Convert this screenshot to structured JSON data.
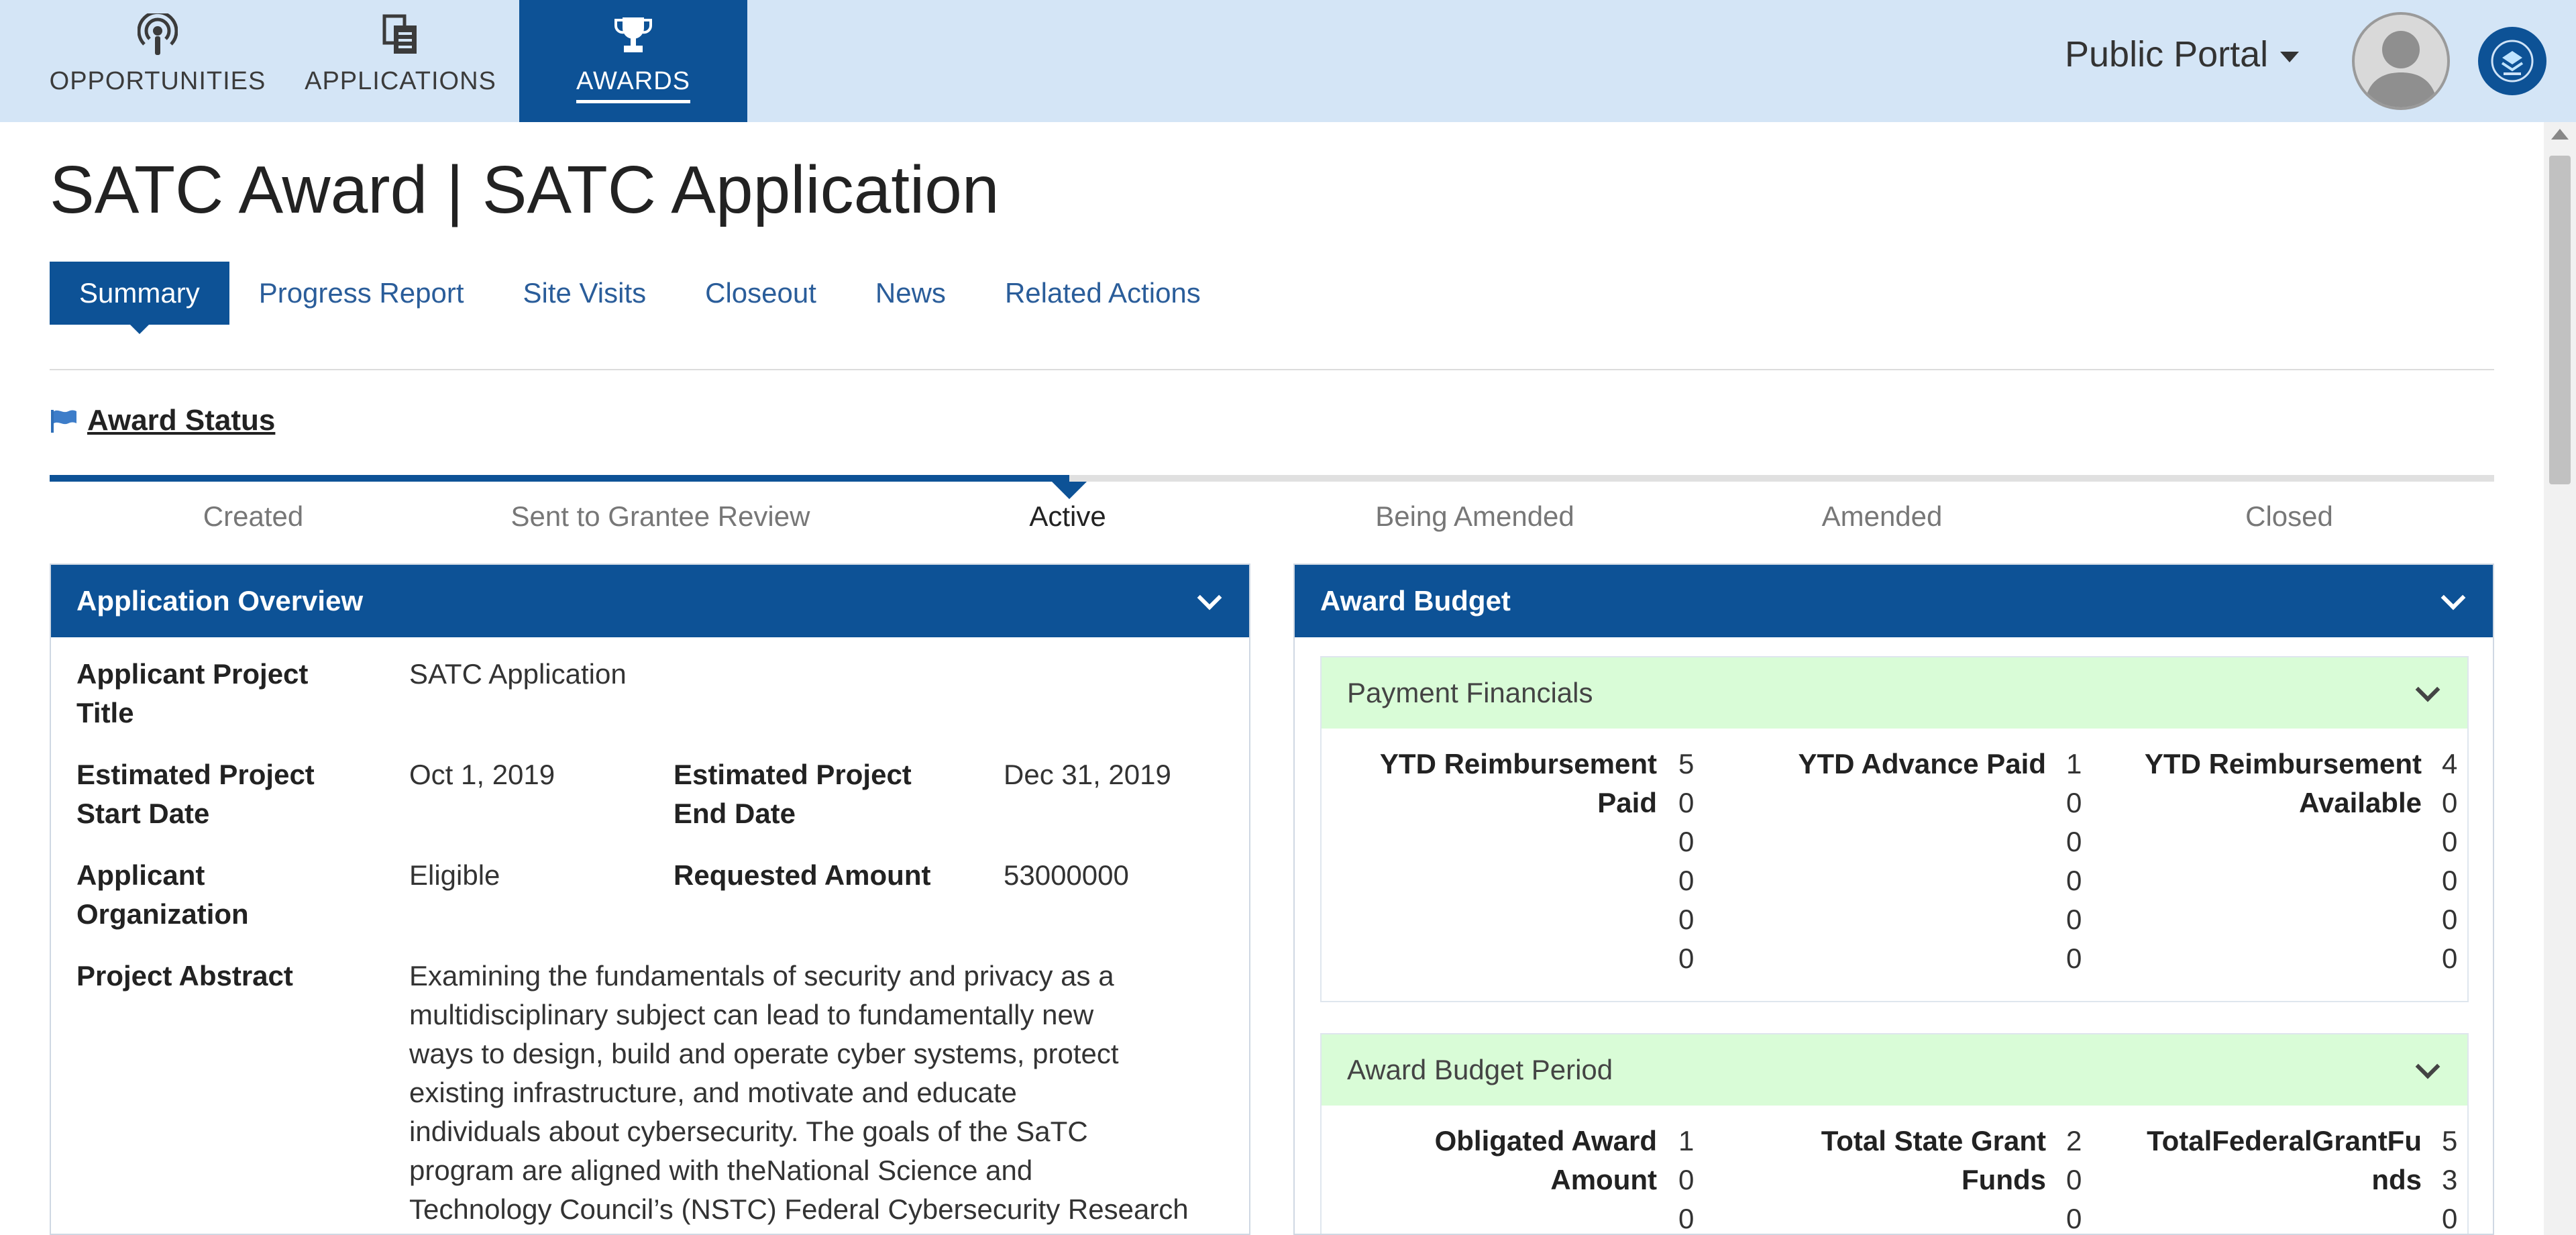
{
  "nav": {
    "items": [
      {
        "label": "OPPORTUNITIES",
        "icon": "podcast-icon"
      },
      {
        "label": "APPLICATIONS",
        "icon": "documents-icon"
      },
      {
        "label": "AWARDS",
        "icon": "trophy-icon",
        "active": true
      }
    ],
    "portal_label": "Public Portal",
    "colors": {
      "bar": "#d4e5f6",
      "active": "#0d5296"
    }
  },
  "page": {
    "title": "SATC Award | SATC Application",
    "tabs": [
      "Summary",
      "Progress Report",
      "Site Visits",
      "Closeout",
      "News",
      "Related Actions"
    ],
    "active_tab": "Summary"
  },
  "award_status": {
    "title": "Award Status",
    "stages": [
      "Created",
      "Sent to Grantee Review",
      "Active",
      "Being Amended",
      "Amended",
      "Closed"
    ],
    "current_stage": "Active",
    "progress_fraction": 0.417
  },
  "overview": {
    "title": "Application Overview",
    "project_title_label": "Applicant Project Title",
    "project_title": "SATC Application",
    "start_label": "Estimated Project Start Date",
    "start_date": "Oct 1, 2019",
    "end_label": "Estimated Project End Date",
    "end_date": "Dec 31, 2019",
    "org_label": "Applicant Organization",
    "org_value": "Eligible",
    "requested_label": "Requested Amount",
    "requested_value": "53000000",
    "abstract_label": "Project Abstract",
    "abstract_lines": [
      "Examining the fundamentals of security and privacy as a",
      "multidisciplinary subject can lead to fundamentally new",
      "ways to design, build and operate cyber systems, protect",
      "existing infrastructure, and motivate and educate",
      "individuals about cybersecurity. The goals of the SaTC",
      "program are aligned with theNational Science and",
      "Technology Council’s (NSTC) Federal Cybersecurity Research"
    ]
  },
  "budget": {
    "title": "Award Budget",
    "payment": {
      "title": "Payment Financials",
      "fields": [
        {
          "label_lines": [
            "YTD Reimbursement",
            "Paid"
          ],
          "digits": [
            "5",
            "0",
            "0",
            "0",
            "0",
            "0"
          ]
        },
        {
          "label_lines": [
            "YTD Advance Paid"
          ],
          "digits": [
            "1",
            "0",
            "0",
            "0",
            "0",
            "0"
          ]
        },
        {
          "label_lines": [
            "YTD Reimbursement",
            "Available"
          ],
          "digits": [
            "4",
            "0",
            "0",
            "0",
            "0",
            "0"
          ]
        }
      ]
    },
    "period": {
      "title": "Award Budget Period",
      "fields": [
        {
          "label_lines": [
            "Obligated Award",
            "Amount"
          ],
          "digits": [
            "1",
            "0",
            "0"
          ]
        },
        {
          "label_lines": [
            "Total State Grant",
            "Funds"
          ],
          "digits": [
            "2",
            "0",
            "0"
          ]
        },
        {
          "label_lines": [
            "TotalFederalGrantFu",
            "nds"
          ],
          "digits": [
            "5",
            "3",
            "0"
          ]
        }
      ]
    },
    "colors": {
      "subheader": "#d9fcd7"
    }
  }
}
